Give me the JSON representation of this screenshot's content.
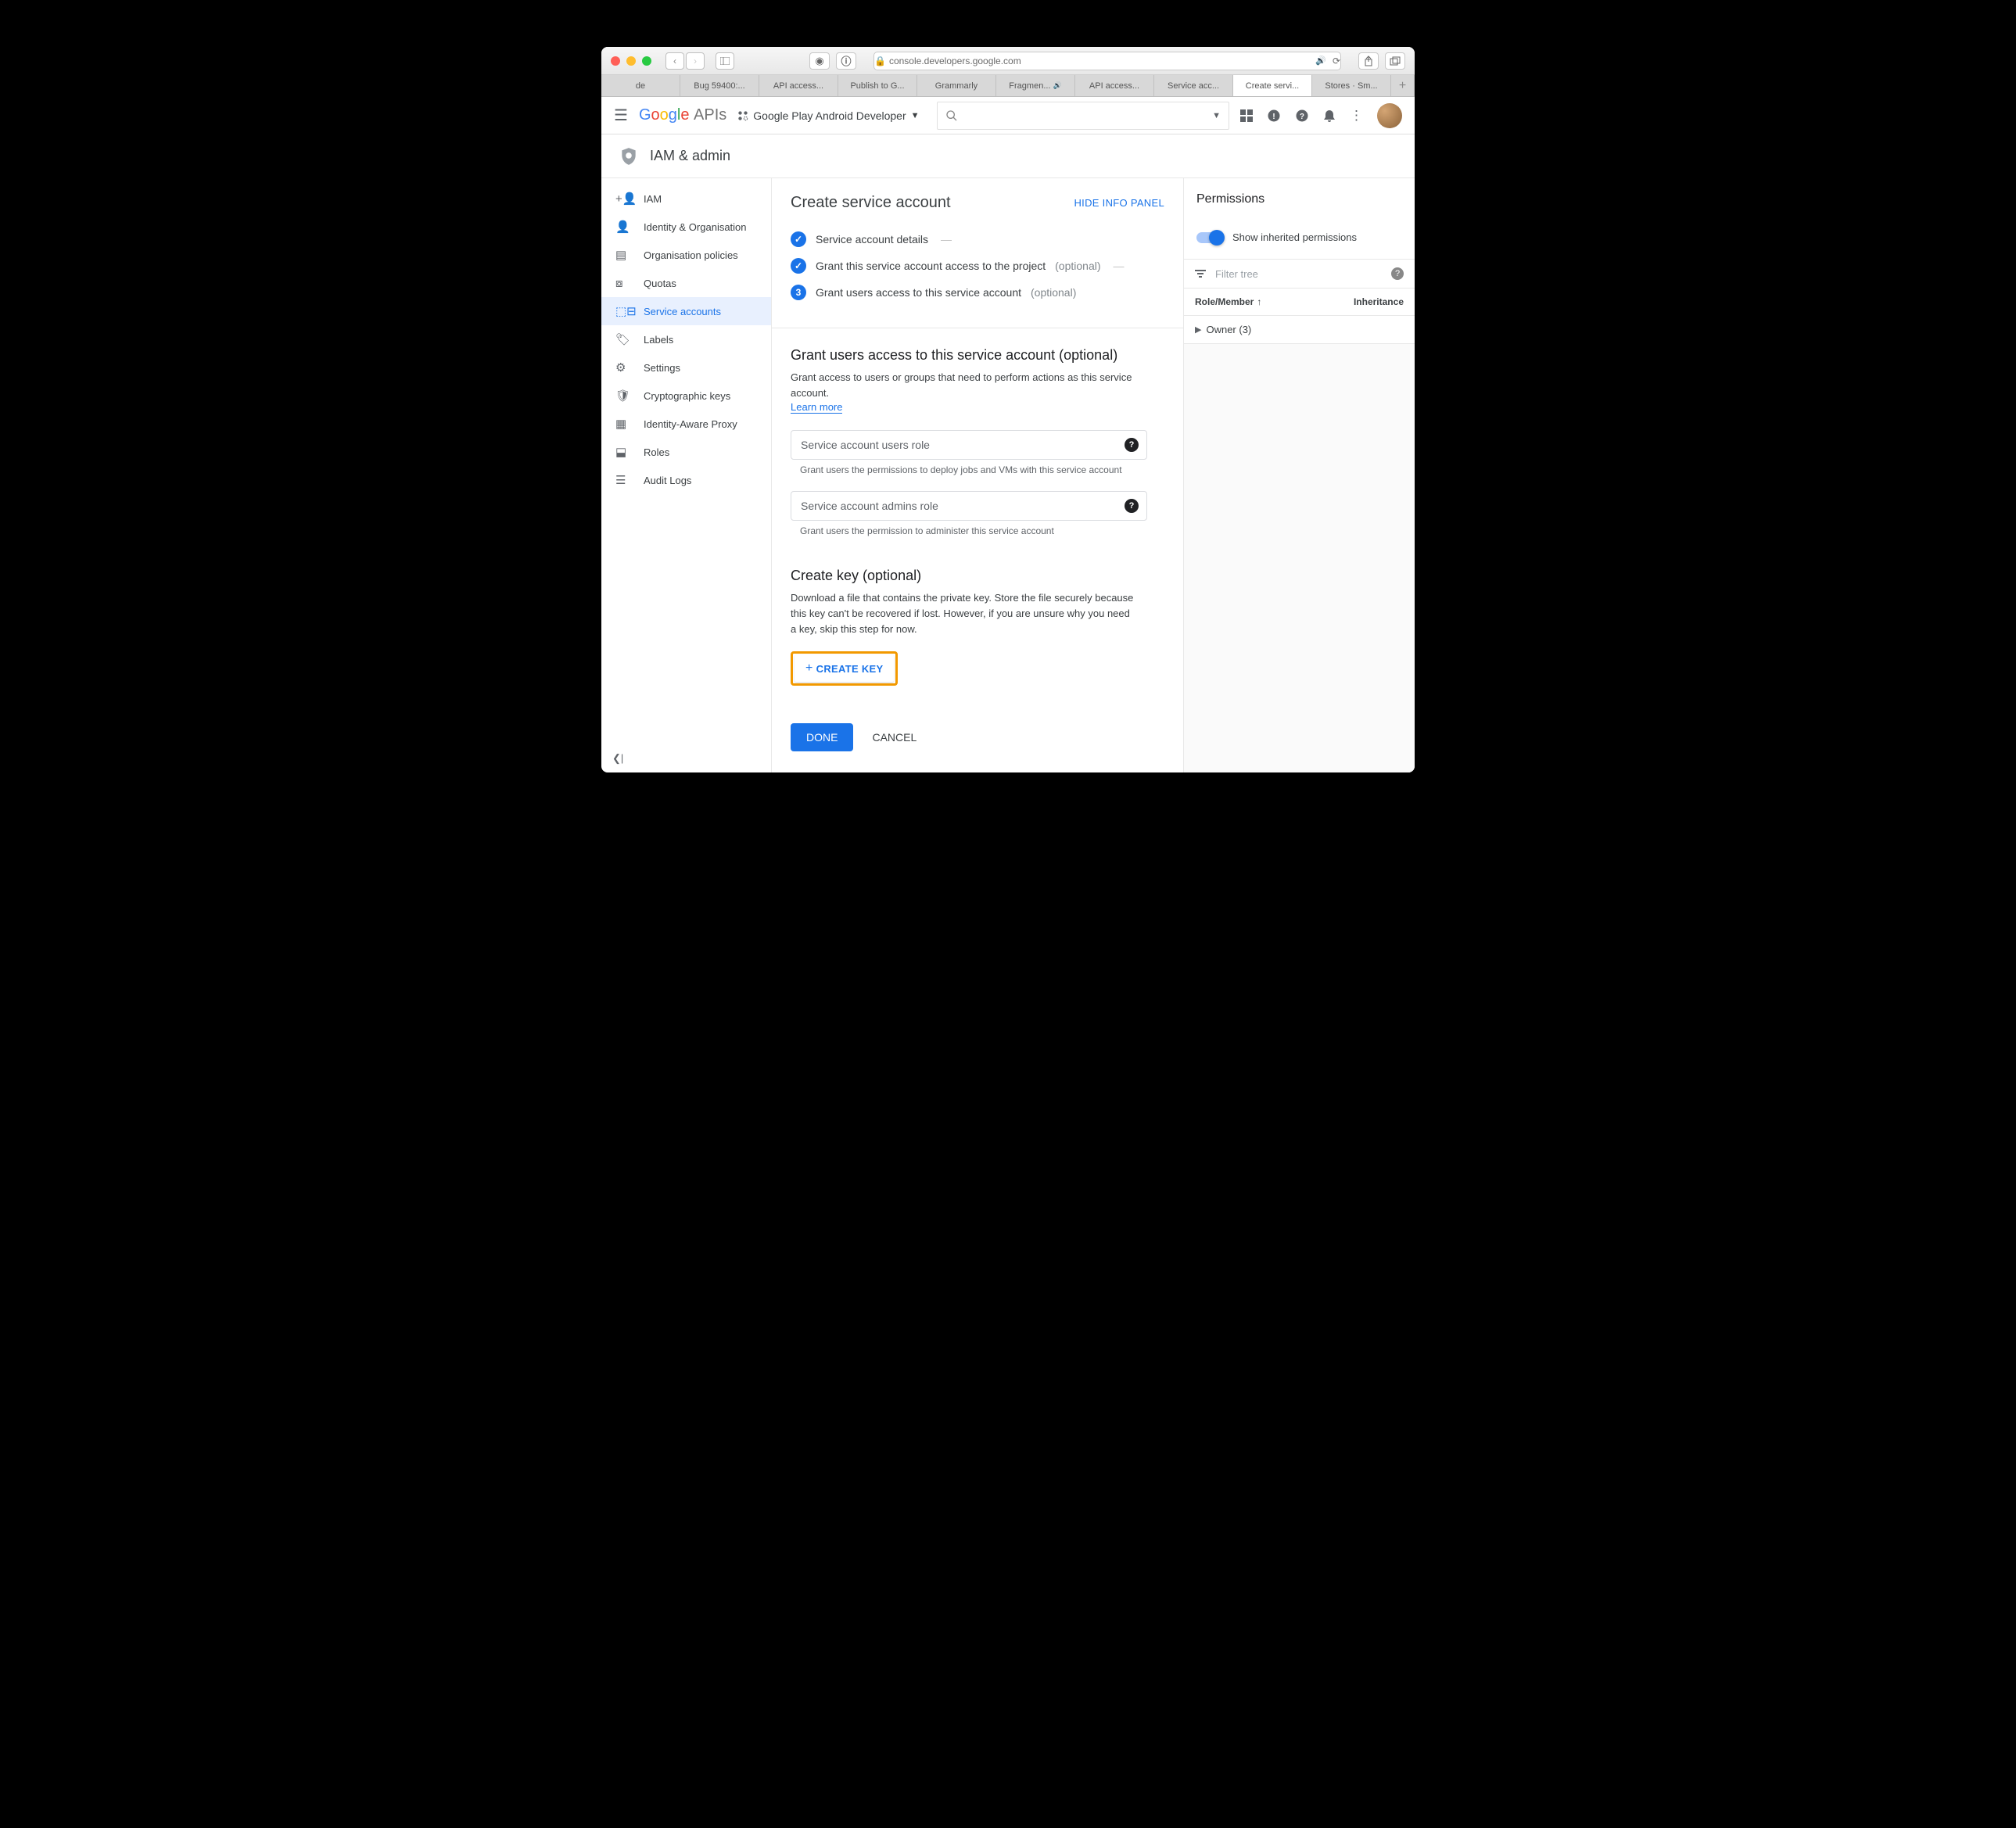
{
  "browser": {
    "url": "console.developers.google.com",
    "tabs": [
      "de",
      "Bug 59400:...",
      "API access...",
      "Publish to G...",
      "Grammarly",
      "Fragmen...",
      "API access...",
      "Service acc...",
      "Create servi...",
      "Stores · Sm..."
    ],
    "active_tab_index": 8,
    "sound_tab_indexes": [
      5
    ]
  },
  "gbar": {
    "logo_apis": "APIs",
    "project": "Google Play Android Developer"
  },
  "page": {
    "section": "IAM & admin",
    "title": "Create service account",
    "hide_panel": "HIDE INFO PANEL"
  },
  "sidebar": [
    {
      "icon": "people",
      "label": "IAM"
    },
    {
      "icon": "person",
      "label": "Identity & Organisation"
    },
    {
      "icon": "doc",
      "label": "Organisation policies"
    },
    {
      "icon": "quota",
      "label": "Quotas"
    },
    {
      "icon": "key",
      "label": "Service accounts"
    },
    {
      "icon": "tag",
      "label": "Labels"
    },
    {
      "icon": "gear",
      "label": "Settings"
    },
    {
      "icon": "shield",
      "label": "Cryptographic keys"
    },
    {
      "icon": "proxy",
      "label": "Identity-Aware Proxy"
    },
    {
      "icon": "roles",
      "label": "Roles"
    },
    {
      "icon": "logs",
      "label": "Audit Logs"
    }
  ],
  "sidebar_active": 4,
  "steps": [
    {
      "label": "Service account details",
      "done": true
    },
    {
      "label": "Grant this service account access to the project",
      "optional": "(optional)",
      "done": true
    },
    {
      "num": "3",
      "label": "Grant users access to this service account",
      "optional": "(optional)"
    }
  ],
  "grant_section": {
    "title": "Grant users access to this service account (optional)",
    "desc": "Grant access to users or groups that need to perform actions as this service account.",
    "learn": "Learn more",
    "field1_label": "Service account users role",
    "field1_hint": "Grant users the permissions to deploy jobs and VMs with this service account",
    "field2_label": "Service account admins role",
    "field2_hint": "Grant users the permission to administer this service account"
  },
  "create_key": {
    "title": "Create key (optional)",
    "desc": "Download a file that contains the private key. Store the file securely because this key can't be recovered if lost. However, if you are unsure why you need a key, skip this step for now.",
    "button": "CREATE KEY"
  },
  "actions": {
    "done": "DONE",
    "cancel": "CANCEL"
  },
  "permissions": {
    "title": "Permissions",
    "toggle_label": "Show inherited permissions",
    "filter_placeholder": "Filter tree",
    "col_role": "Role/Member",
    "col_inh": "Inheritance",
    "owner_row": "Owner (3)"
  }
}
